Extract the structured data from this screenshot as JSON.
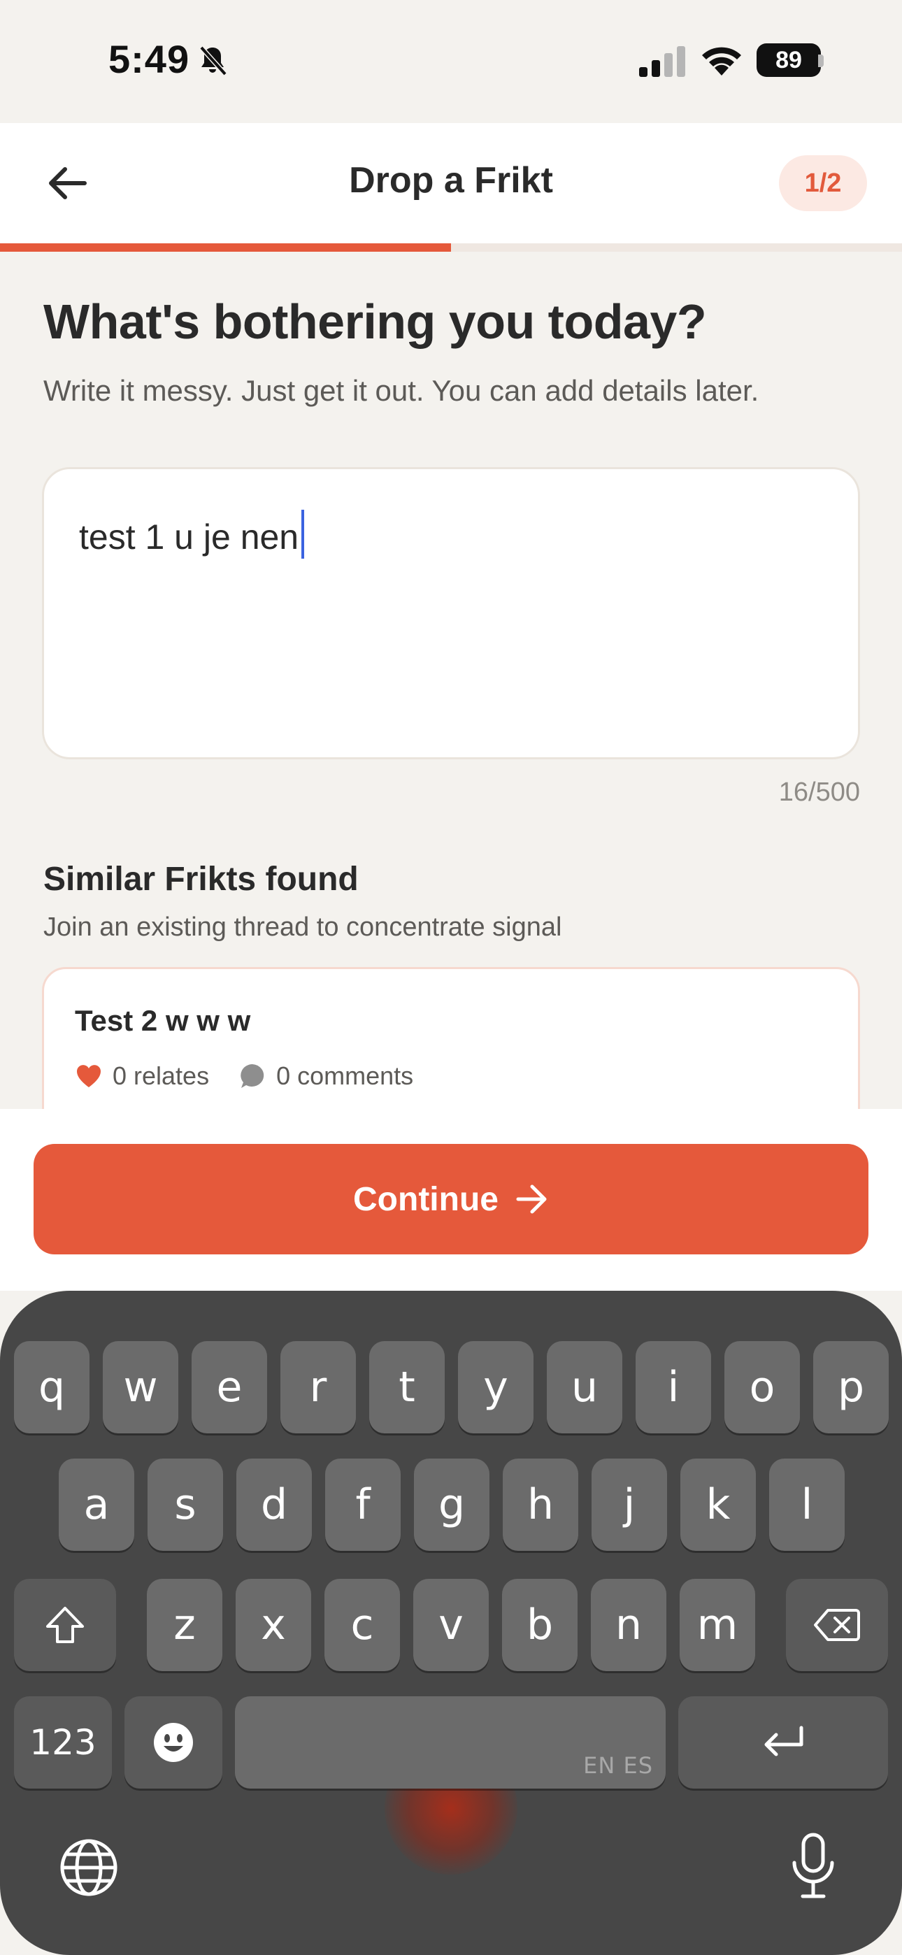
{
  "status_bar": {
    "time": "5:49",
    "battery": "89",
    "icons": [
      "bell-off-icon",
      "signal-icon",
      "wifi-icon",
      "battery-icon"
    ]
  },
  "header": {
    "title": "Drop a Frikt",
    "step": "1/2",
    "back_icon": "arrow-left-icon",
    "progress_fraction": 0.5
  },
  "prompt": {
    "title": "What's bothering you today?",
    "subtitle": "Write it messy. Just get it out. You can add details later.",
    "input_value": "test 1 u je nen",
    "char_count": "16/500"
  },
  "similar": {
    "title": "Similar Frikts found",
    "subtitle": "Join an existing thread to concentrate signal",
    "items": [
      {
        "title": "Test 2 w w w",
        "relates": "0 relates",
        "comments": "0 comments"
      }
    ]
  },
  "actions": {
    "continue_label": "Continue"
  },
  "keyboard": {
    "row1": [
      "q",
      "w",
      "e",
      "r",
      "t",
      "y",
      "u",
      "i",
      "o",
      "p"
    ],
    "row2": [
      "a",
      "s",
      "d",
      "f",
      "g",
      "h",
      "j",
      "k",
      "l"
    ],
    "row3": [
      "z",
      "x",
      "c",
      "v",
      "b",
      "n",
      "m"
    ],
    "numbers_label": "123",
    "space_lang": "EN ES"
  },
  "colors": {
    "accent": "#E5593B",
    "background": "#F4F2EE",
    "badge_bg": "#FCE9E3",
    "cursor": "#3B63E0"
  }
}
